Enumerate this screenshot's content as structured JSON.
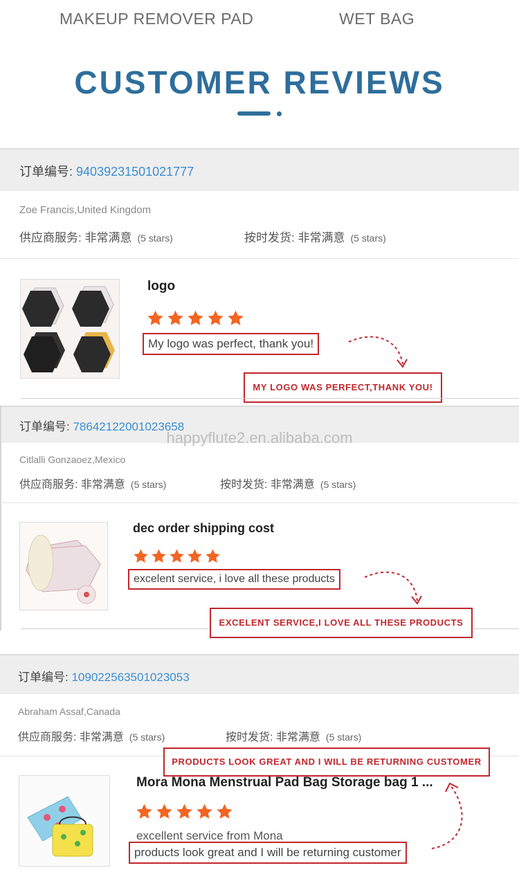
{
  "tabs": [
    "MAKEUP REMOVER PAD",
    "WET BAG"
  ],
  "section_title": "CUSTOMER REVIEWS",
  "watermark": "happyflute2.en.alibaba.com",
  "colors": {
    "title_blue": "#2e6e9b",
    "order_blue": "#3a8ed3",
    "star_orange": "#f26522",
    "annotation_red": "#c1272d"
  },
  "reviews": [
    {
      "order_label": "订单编号:",
      "order_no": "94039231501021777",
      "buyer": "Zoe Francis,United Kingdom",
      "supplier_service": "供应商服务: 非常满意",
      "supplier_stars": "(5 stars)",
      "shipping": "按时发货: 非常满意",
      "shipping_stars": "(5 stars)",
      "product": "logo",
      "rating": 5,
      "comment": "My logo was perfect, thank you!",
      "translation": "MY LOGO WAS PERFECT,THANK YOU!"
    },
    {
      "order_label": "订单编号:",
      "order_no": "78642122001023658",
      "buyer": "Citlalli Gonzaoez,Mexico",
      "supplier_service": "供应商服务: 非常满意",
      "supplier_stars": "(5 stars)",
      "shipping": "按时发货: 非常满意",
      "shipping_stars": "(5 stars)",
      "product": "dec order shipping cost",
      "rating": 5,
      "comment": "excelent service, i love all these products",
      "translation": "EXCELENT SERVICE,I LOVE ALL THESE PRODUCTS"
    },
    {
      "order_label": "订单编号:",
      "order_no": "109022563501023053",
      "buyer": "Abraham Assaf,Canada",
      "supplier_service": "供应商服务: 非常满意",
      "supplier_stars": "(5 stars)",
      "shipping": "按时发货: 非常满意",
      "shipping_stars": "(5 stars)",
      "product": "Mora Mona Menstrual Pad Bag Storage bag 1 ...",
      "rating": 5,
      "comment_line1": "excellent service from Mona",
      "comment": "products look great and I will be returning customer",
      "translation": "PRODUCTS LOOK GREAT AND I WILL BE RETURNING CUSTOMER"
    }
  ]
}
